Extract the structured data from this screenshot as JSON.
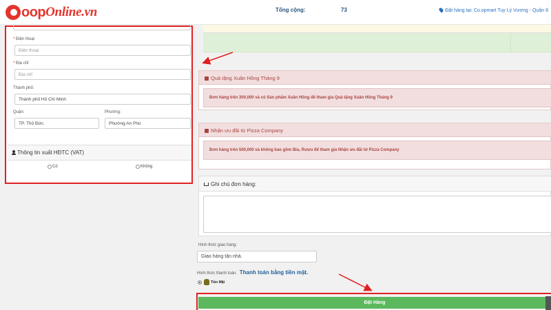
{
  "header": {
    "logo_coop": "Coop",
    "logo_online": "Online.vn",
    "store_text": "Đặt hàng tại: Co.opmart Tuy Lý Vương - Quận 8"
  },
  "form": {
    "phone_label": "Điện thoại",
    "phone_placeholder": "Điện thoại",
    "address_label": "Địa chỉ",
    "address_placeholder": "Địa chỉ",
    "city_label": "Thành phố:",
    "city_value": "Thành phố Hồ Chí Minh",
    "district_label": "Quận:",
    "district_value": "TP. Thủ Đức",
    "ward_label": "Phường:",
    "ward_value": "Phường An Phú",
    "required_mark": "*"
  },
  "vat": {
    "title": "Thông tin xuất HĐTC (VAT)",
    "option_yes": "Có",
    "option_no": "Không"
  },
  "totals": {
    "label": "Tổng cộng:",
    "value": "73"
  },
  "promos": [
    {
      "title": "Quà tặng Xuân Hồng Tháng 9",
      "text": "Đơn hàng trên 300,000 và có Sản phẩm Xuân Hồng để tham gia Quà tặng Xuân Hồng Tháng 9"
    },
    {
      "title": "Nhận ưu đãi từ Pizza Company",
      "text": "Đơn hàng trên 500,000 và không bao gồm Bia, Rượu để tham gia Nhận ưu đãi từ Pizza Company"
    }
  ],
  "note": {
    "title": "Ghi chú đơn hàng:"
  },
  "shipping": {
    "label": "Hình thức giao hàng:",
    "value": "Giao hàng tận nhà."
  },
  "payment": {
    "label": "Hình thức thanh toán:",
    "value": "Thanh toán bằng tiền mặt.",
    "option_cash": "Tiền Mặt"
  },
  "order_button": "Đặt Hàng",
  "colors": {
    "brand_red": "#e4342c",
    "annotation_red": "#e02020",
    "order_green": "#5cb85c",
    "promo_red_text": "#a94442"
  }
}
